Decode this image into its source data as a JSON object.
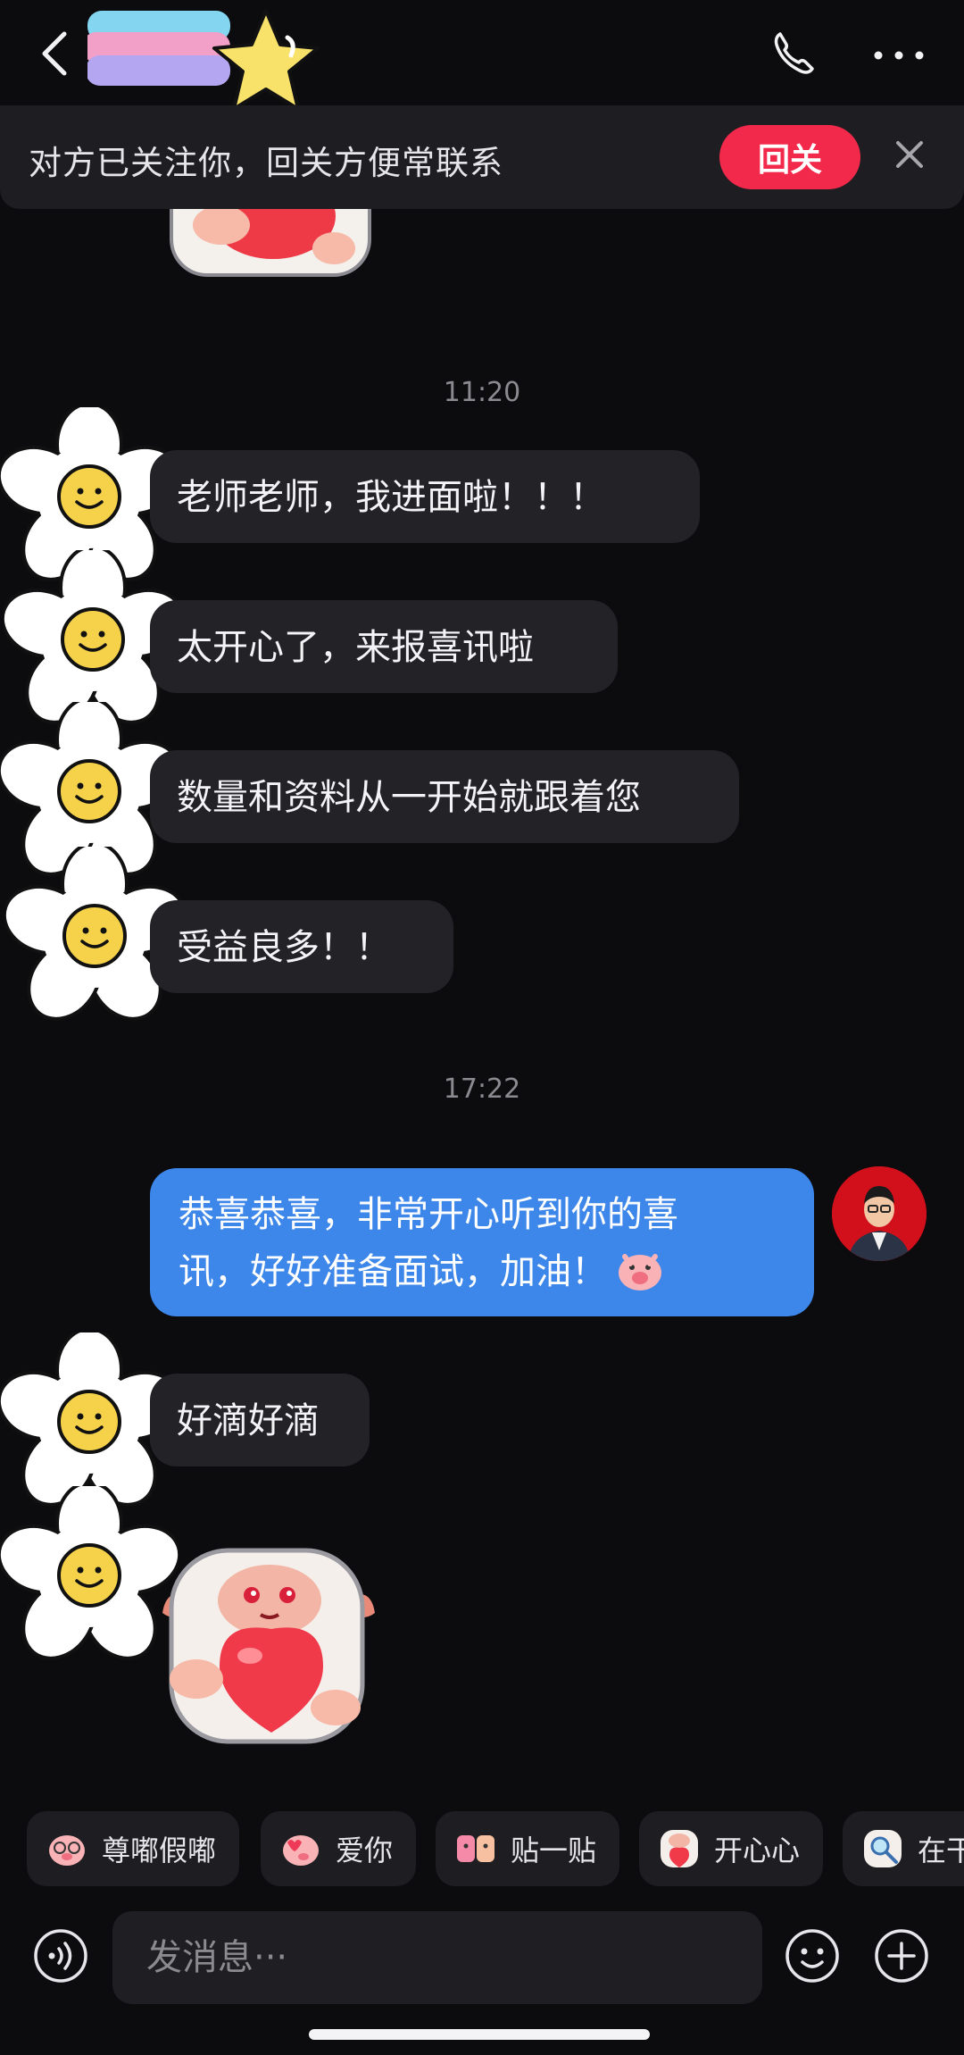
{
  "header": {
    "back_icon": "chevron-left-icon",
    "title_sticker": "rainbow-star-sticker",
    "call_icon": "phone-icon",
    "more_icon": "more-dots-icon"
  },
  "banner": {
    "text": "对方已关注你，回关方便常联系",
    "follow_button": "回关",
    "close_icon": "close-icon"
  },
  "messages": {
    "time_1": "11:20",
    "incoming_1": "老师老师，我进面啦！！！",
    "incoming_2": "太开心了，来报喜讯啦",
    "incoming_3": "数量和资料从一开始就跟着您",
    "incoming_4": "受益良多！！",
    "time_2": "17:22",
    "outgoing_line_1": "恭喜恭喜，非常开心听到你的喜",
    "outgoing_line_2": "讯，好好准备面试，加油！",
    "incoming_5": "好滴好滴"
  },
  "quick_replies": [
    {
      "label": "尊嘟假嘟",
      "icon": "piggy-glasses-sticker-icon"
    },
    {
      "label": "爱你",
      "icon": "piggy-love-sticker-icon"
    },
    {
      "label": "贴一贴",
      "icon": "piggy-hug-sticker-icon"
    },
    {
      "label": "开心心",
      "icon": "sheep-heart-sticker-icon"
    },
    {
      "label": "在干",
      "icon": "sheep-search-sticker-icon"
    }
  ],
  "input": {
    "placeholder": "发消息···",
    "voice_icon": "voice-icon",
    "emoji_icon": "emoji-icon",
    "plus_icon": "plus-icon"
  },
  "colors": {
    "background": "#0c0c0f",
    "incoming_bubble": "#232327",
    "outgoing_bubble": "#3d86ea",
    "follow_button": "#f2294a"
  }
}
